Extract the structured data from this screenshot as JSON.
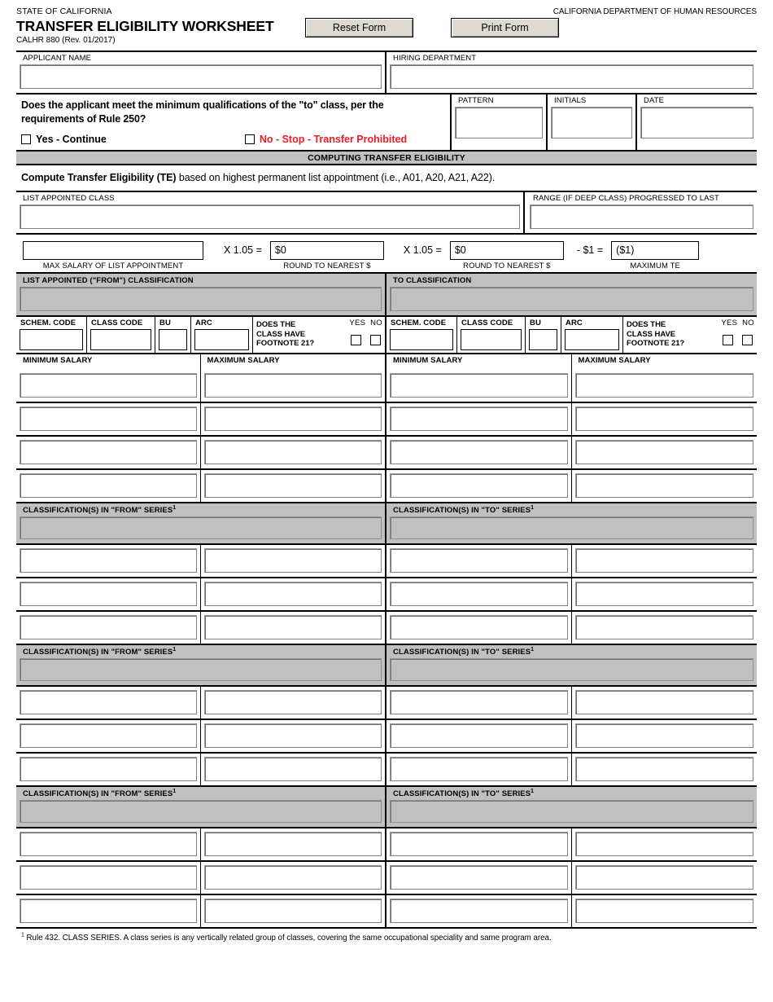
{
  "header": {
    "state_line": "STATE OF CALIFORNIA",
    "title": "TRANSFER ELIGIBILITY WORKSHEET",
    "revision": "CALHR 880 (Rev. 01/2017)",
    "agency": "CALIFORNIA DEPARTMENT OF HUMAN RESOURCES",
    "reset_button": "Reset Form",
    "print_button": "Print Form"
  },
  "applicant": {
    "name_label": "APPLICANT NAME",
    "name_value": "",
    "department_label": "HIRING DEPARTMENT",
    "department_value": ""
  },
  "qualification": {
    "question": "Does the applicant meet the minimum qualifications of the \"to\" class, per the requirements of Rule 250?",
    "yes_label": "Yes - Continue",
    "no_label": "No - Stop - Transfer Prohibited",
    "no_color": "#ed1c24",
    "pattern_label": "PATTERN",
    "pattern_value": "",
    "initials_label": "INITIALS",
    "initials_value": "",
    "date_label": "DATE",
    "date_value": ""
  },
  "compute": {
    "band_title": "COMPUTING TRANSFER ELIGIBILITY",
    "instruction_bold": "Compute Transfer Eligibility (TE)",
    "instruction_rest": " based on highest permanent list appointment (i.e., A01, A20, A21, A22).",
    "list_class_label": "LIST APPOINTED CLASS",
    "list_class_value": "",
    "range_label": "RANGE (IF DEEP CLASS) PROGRESSED TO LAST",
    "range_value": "",
    "max_salary_value": "",
    "max_salary_caption": "MAX SALARY OF LIST APPOINTMENT",
    "op1": "X 1.05 =",
    "step1_value": "$0",
    "step1_caption": "ROUND TO NEAREST $",
    "op2": "X 1.05 =",
    "step2_value": "$0",
    "step2_caption": "ROUND TO NEAREST $",
    "op3": "- $1 =",
    "result_value": "($1)",
    "result_caption": "MAXIMUM TE"
  },
  "classification": {
    "from_title": "LIST APPOINTED (\"FROM\") CLASSIFICATION",
    "from_value": "",
    "to_title": "TO CLASSIFICATION",
    "to_value": "",
    "schem_code_label": "SCHEM. CODE",
    "class_code_label": "CLASS CODE",
    "bu_label": "BU",
    "arc_label": "ARC",
    "footnote21_line1": "DOES THE",
    "footnote21_line2": "CLASS HAVE",
    "footnote21_line3": "FOOTNOTE 21?",
    "yes_short": "YES",
    "no_short": "NO",
    "min_salary_label": "MINIMUM SALARY",
    "max_salary_label": "MAXIMUM SALARY",
    "salary_rows": [
      {
        "from_min": "",
        "from_max": "",
        "to_min": "",
        "to_max": ""
      },
      {
        "from_min": "",
        "from_max": "",
        "to_min": "",
        "to_max": ""
      },
      {
        "from_min": "",
        "from_max": "",
        "to_min": "",
        "to_max": ""
      },
      {
        "from_min": "",
        "from_max": "",
        "to_min": "",
        "to_max": ""
      }
    ]
  },
  "series": {
    "from_title_text": "CLASSIFICATION(S) IN \"FROM\" SERIES",
    "to_title_text": "CLASSIFICATION(S) IN \"TO\" SERIES",
    "superscript": "1",
    "blocks": [
      {
        "from_value": "",
        "to_value": "",
        "rows": [
          {
            "from_a": "",
            "from_b": "",
            "to_a": "",
            "to_b": ""
          },
          {
            "from_a": "",
            "from_b": "",
            "to_a": "",
            "to_b": ""
          },
          {
            "from_a": "",
            "from_b": "",
            "to_a": "",
            "to_b": ""
          }
        ]
      },
      {
        "from_value": "",
        "to_value": "",
        "rows": [
          {
            "from_a": "",
            "from_b": "",
            "to_a": "",
            "to_b": ""
          },
          {
            "from_a": "",
            "from_b": "",
            "to_a": "",
            "to_b": ""
          },
          {
            "from_a": "",
            "from_b": "",
            "to_a": "",
            "to_b": ""
          }
        ]
      },
      {
        "from_value": "",
        "to_value": "",
        "rows": [
          {
            "from_a": "",
            "from_b": "",
            "to_a": "",
            "to_b": ""
          },
          {
            "from_a": "",
            "from_b": "",
            "to_a": "",
            "to_b": ""
          },
          {
            "from_a": "",
            "from_b": "",
            "to_a": "",
            "to_b": ""
          }
        ]
      }
    ]
  },
  "footer": {
    "marker": "1",
    "text": "Rule 432. CLASS SERIES. A class series is any vertically related group of classes, covering the same occupational speciality and same program area."
  }
}
